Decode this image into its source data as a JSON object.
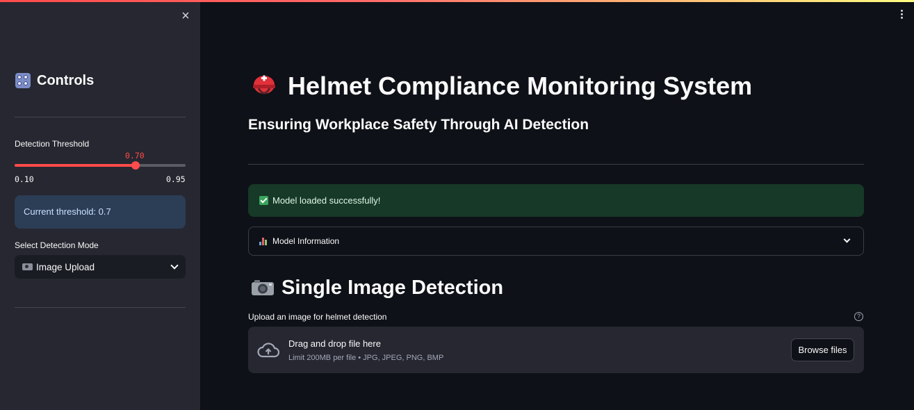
{
  "sidebar": {
    "close_glyph": "×",
    "title": "Controls",
    "title_icon": "control-knobs-icon",
    "threshold": {
      "label": "Detection Threshold",
      "value_text": "0.70",
      "value": 0.7,
      "min_text": "0.10",
      "max_text": "0.95",
      "min": 0.1,
      "max": 0.95
    },
    "threshold_info": "Current threshold: 0.7",
    "mode": {
      "label": "Select Detection Mode",
      "selected": "Image Upload",
      "icon": "camera-icon"
    }
  },
  "header": {
    "title": "Helmet Compliance Monitoring System",
    "title_icon": "rescue-helmet-icon",
    "subtitle": "Ensuring Workplace Safety Through AI Detection"
  },
  "status": {
    "success_message": "Model loaded successfully!",
    "icon": "check-mark-icon"
  },
  "expander": {
    "label": "Model Information",
    "icon": "bar-chart-icon"
  },
  "section": {
    "title": "Single Image Detection",
    "icon": "camera-icon"
  },
  "uploader": {
    "label": "Upload an image for helmet detection",
    "help_glyph": "?",
    "drop_text": "Drag and drop file here",
    "limit_text": "Limit 200MB per file • JPG, JPEG, PNG, BMP",
    "browse_label": "Browse files"
  },
  "colors": {
    "accent": "#ff4b4b",
    "background": "#0e1117",
    "sidebar": "#262730",
    "success_bg": "#173928",
    "info_bg": "#2c3d56"
  }
}
